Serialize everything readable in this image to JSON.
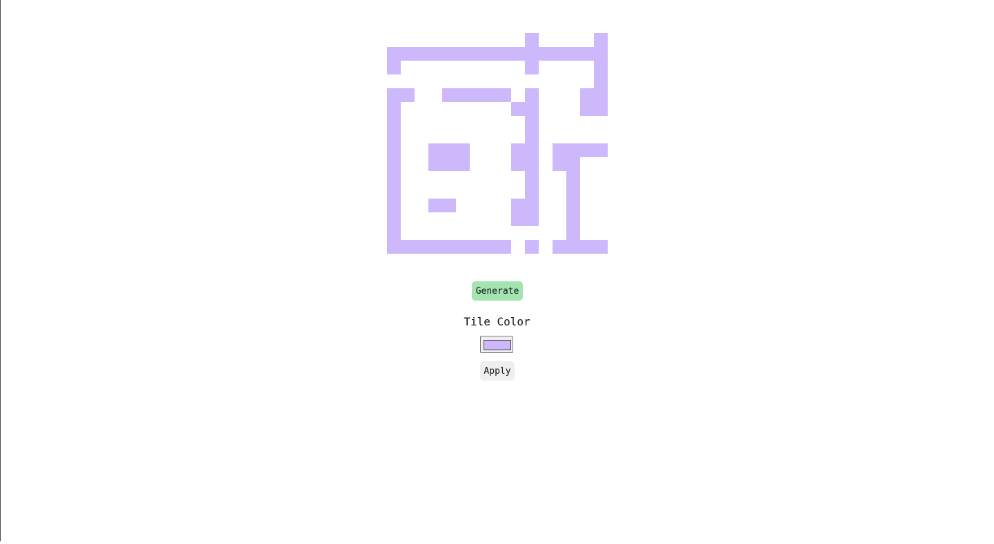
{
  "tile_color": "#cdb8fb",
  "generate_button": {
    "label": "Generate",
    "color": "#a3e4b1"
  },
  "tile_color_section": {
    "label": "Tile Color",
    "value": "#cdb8fb"
  },
  "apply_button": {
    "label": "Apply"
  },
  "grid": {
    "rows": 16,
    "cols": 16,
    "pattern": [
      "0000000000100001",
      "1111111111111111",
      "1000000000100001",
      "0000000000000001",
      "1100111110100011",
      "1000000001100011",
      "1000000000100000",
      "1000000000100000",
      "1001110001101111",
      "1001110001101100",
      "1000000000100100",
      "1000000000100100",
      "1001100001100100",
      "1000000001100100",
      "1000000000000100",
      "1111111110101111"
    ]
  }
}
